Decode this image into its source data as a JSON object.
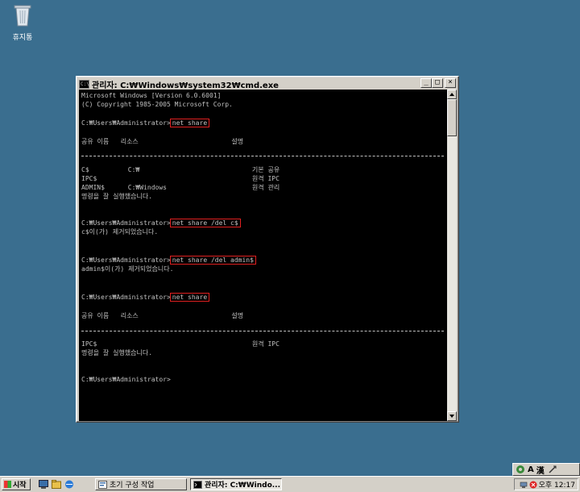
{
  "desktop": {
    "recycle_bin_label": "휴지통"
  },
  "window": {
    "title": "관리자: C:₩Windows₩system32₩cmd.exe",
    "icon_text": "C:\\",
    "minimize": "_",
    "maximize": "□",
    "close": "×"
  },
  "console": {
    "lines": [
      "Microsoft Windows [Version 6.0.6001]",
      "(C) Copyright 1985-2005 Microsoft Corp.",
      "C:₩Users₩Administrator>",
      "공유 이름   리소스                        설명",
      "C$          C:₩                             기본 공유",
      "IPC$                                        원격 IPC",
      "ADMIN$      C:₩Windows                      원격 관리",
      "명령을 잘 실행했습니다.",
      "C:₩Users₩Administrator>",
      "c$이(가) 제거되었습니다.",
      "C:₩Users₩Administrator>",
      "admin$이(가) 제거되었습니다.",
      "C:₩Users₩Administrator>",
      "공유 이름   리소스                        설명",
      "IPC$                                        원격 IPC",
      "명령을 잘 실행했습니다.",
      "C:₩Users₩Administrator>"
    ],
    "commands": [
      "net share",
      "net share /del c$",
      "net share /del admin$",
      "net share"
    ]
  },
  "taskbar": {
    "start_label": "시작",
    "tasks": [
      "초기 구성 작업",
      "관리자: C:₩Windo..."
    ],
    "clock": "오후 12:17"
  },
  "language_bar": {
    "mode": "A",
    "hanja": "漢"
  },
  "colors": {
    "desktop": "#3a6e8f",
    "console_bg": "#000000",
    "console_text": "#c0c0c0",
    "highlight": "#e02020"
  }
}
